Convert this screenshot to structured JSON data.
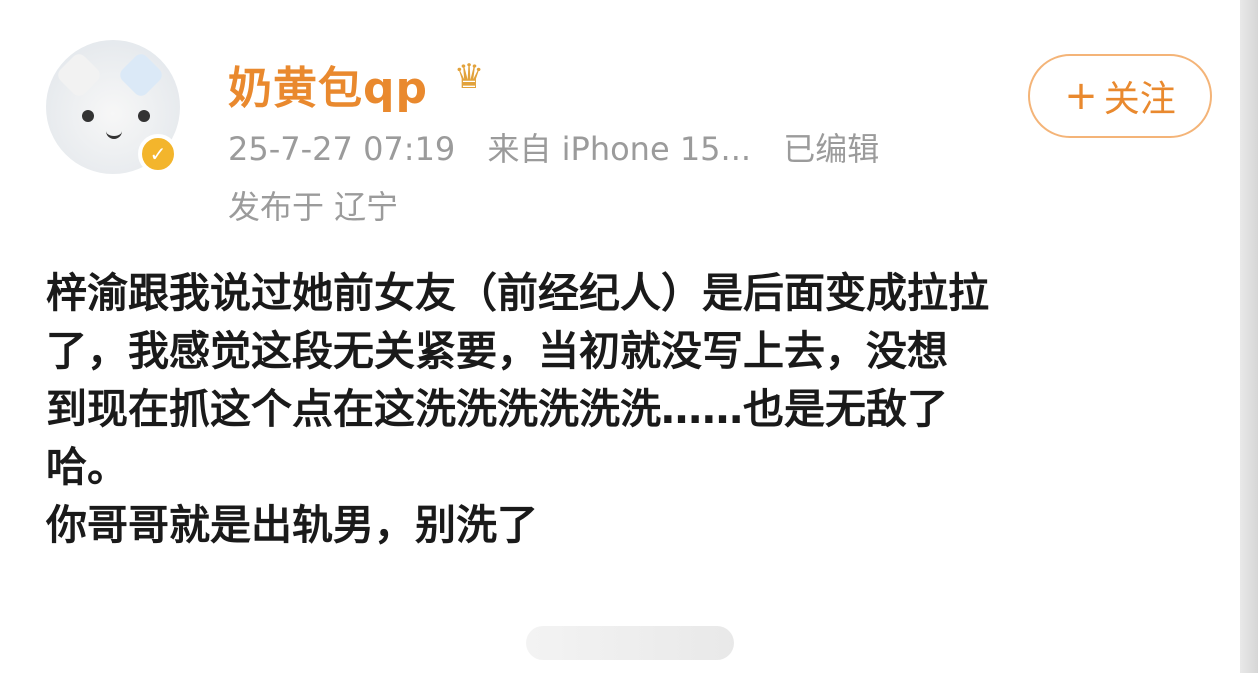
{
  "post": {
    "username": "奶黄包qp",
    "date": "25-7-27 07:19",
    "source": "来自 iPhone 15...",
    "edited": "已编辑",
    "location": "发布于 辽宁",
    "follow_label": "关注",
    "body_lines": [
      "梓渝跟我说过她前女友（前经纪人）是后面变成拉拉",
      "了，我感觉这段无关紧要，当初就没写上去，没想",
      "到现在抓这个点在这洗洗洗洗洗洗……也是无敌了",
      "哈。",
      "你哥哥就是出轨男，别洗了"
    ]
  },
  "icons": {
    "verified": "verified-badge-icon",
    "vip": "vip-crown-icon",
    "plus": "plus-icon"
  },
  "colors": {
    "username": "#e9892e",
    "meta": "#9b9b9b",
    "follow_border": "#f4b478",
    "verified": "#f3b52c"
  }
}
